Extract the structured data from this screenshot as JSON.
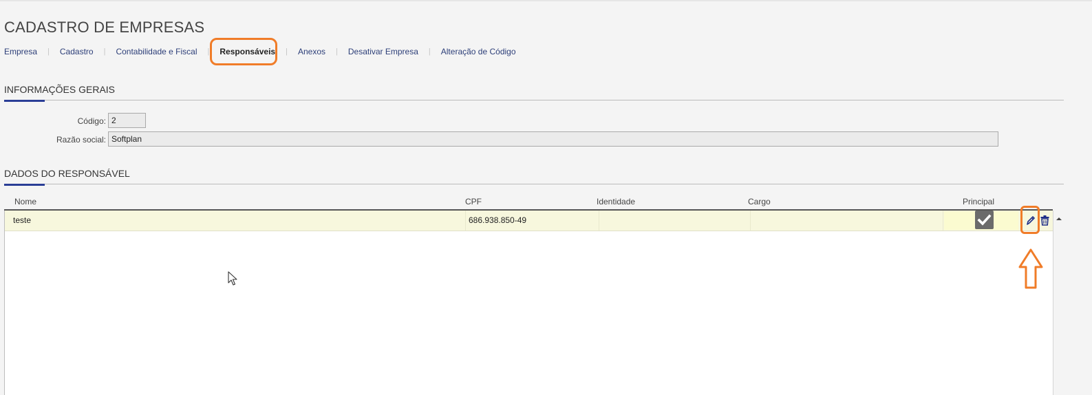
{
  "page": {
    "title": "CADASTRO DE EMPRESAS"
  },
  "tabs": [
    {
      "label": "Empresa",
      "active": false
    },
    {
      "label": "Cadastro",
      "active": false
    },
    {
      "label": "Contabilidade e Fiscal",
      "active": false
    },
    {
      "label": "Responsáveis",
      "active": true
    },
    {
      "label": "Anexos",
      "active": false
    },
    {
      "label": "Desativar Empresa",
      "active": false
    },
    {
      "label": "Alteração de Código",
      "active": false
    }
  ],
  "general_info": {
    "title": "INFORMAÇÕES GERAIS",
    "code_label": "Código:",
    "code_value": "2",
    "company_name_label": "Razão social:",
    "company_name_value": "Softplan"
  },
  "responsible": {
    "title": "DADOS DO RESPONSÁVEL",
    "columns": [
      "Nome",
      "CPF",
      "Identidade",
      "Cargo",
      "Principal"
    ],
    "rows": [
      {
        "nome": "teste",
        "cpf": "686.938.850-49",
        "identidade": "",
        "cargo": "",
        "principal": true
      }
    ]
  },
  "icons": {
    "check": "check-icon",
    "edit": "pencil-icon",
    "delete": "trash-icon",
    "scroll_up": "caret-up-icon",
    "cursor": "mouse-pointer-icon"
  },
  "colors": {
    "accent": "#2a3e96",
    "link": "#2c3e78",
    "highlight_annotation": "#f07c28",
    "selected_row": "#f7f7dd"
  }
}
